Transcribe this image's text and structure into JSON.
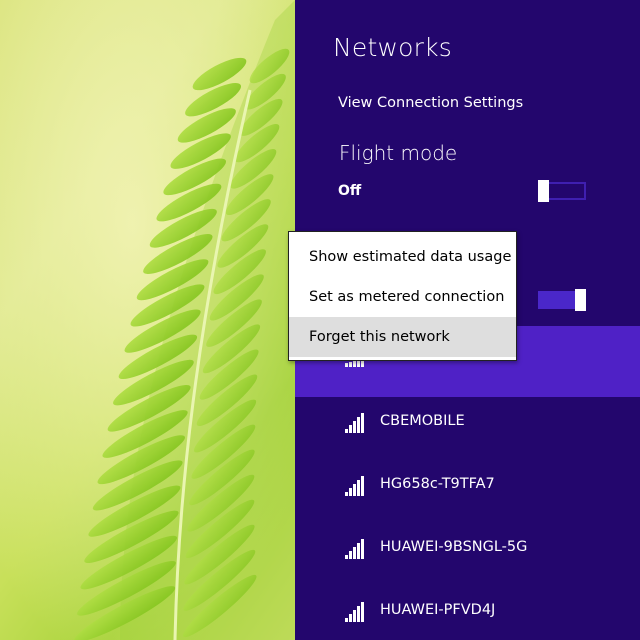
{
  "pane": {
    "title": "Networks",
    "view_connection_settings": "View Connection Settings",
    "flight_mode": {
      "title": "Flight mode",
      "state_label": "Off",
      "on": false
    },
    "wifi_toggle": {
      "on": true
    }
  },
  "context_menu": {
    "items": [
      {
        "label": "Show estimated data usage"
      },
      {
        "label": "Set as metered connection"
      },
      {
        "label": "Forget this network",
        "highlighted": true
      }
    ]
  },
  "networks": [
    {
      "ssid": "",
      "signal_bars": 5,
      "selected": true,
      "icon": "wifi-signal-icon"
    },
    {
      "ssid": "CBEMOBILE",
      "signal_bars": 5,
      "icon": "wifi-signal-icon"
    },
    {
      "ssid": "HG658c-T9TFA7",
      "signal_bars": 5,
      "icon": "wifi-signal-icon"
    },
    {
      "ssid": "HUAWEI-9BSNGL-5G",
      "signal_bars": 5,
      "icon": "wifi-signal-icon"
    },
    {
      "ssid": "HUAWEI-PFVD4J",
      "signal_bars": 5,
      "icon": "wifi-signal-icon"
    }
  ],
  "colors": {
    "pane_background": "#23066d",
    "selected_row": "#4f21c6",
    "toggle_on": "#4a27c9",
    "menu_highlight": "#dedede"
  }
}
